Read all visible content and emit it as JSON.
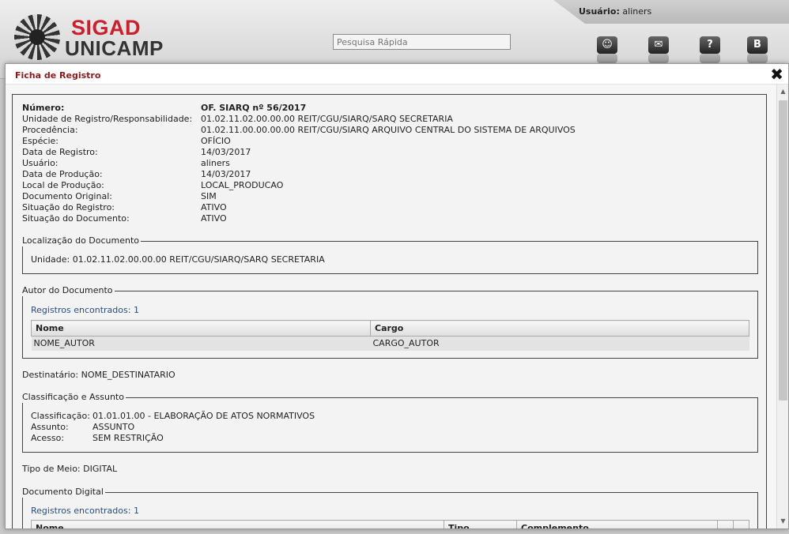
{
  "header": {
    "logo_line1": "SIGAD",
    "logo_line2": "UNICAMP",
    "search_placeholder": "Pesquisa Rápida",
    "user_label": "Usuário:",
    "user_name": "aliners",
    "icons": [
      "user-icon",
      "chat-icon",
      "help-icon",
      "logout-icon"
    ]
  },
  "modal": {
    "title": "Ficha de Registro",
    "close_symbol": "✖"
  },
  "registro": {
    "fields": [
      {
        "label": "Número:",
        "value": "OF. SIARQ nº 56/2017"
      },
      {
        "label": "Unidade de Registro/Responsabilidade:",
        "value": "01.02.11.02.00.00.00 REIT/CGU/SIARQ/SARQ SECRETARIA"
      },
      {
        "label": "Procedência:",
        "value": "01.02.11.00.00.00.00 REIT/CGU/SIARQ ARQUIVO CENTRAL DO SISTEMA DE ARQUIVOS"
      },
      {
        "label": "Espécie:",
        "value": "OFÍCIO"
      },
      {
        "label": "Data de Registro:",
        "value": "14/03/2017"
      },
      {
        "label": "Usuário:",
        "value": "aliners"
      },
      {
        "label": "Data de Produção:",
        "value": "14/03/2017"
      },
      {
        "label": "Local de Produção:",
        "value": "LOCAL_PRODUCAO"
      },
      {
        "label": "Documento Original:",
        "value": "SIM"
      },
      {
        "label": "Situação do Registro:",
        "value": "ATIVO"
      },
      {
        "label": "Situação do Documento:",
        "value": "ATIVO"
      }
    ]
  },
  "localizacao": {
    "legend": "Localização do Documento",
    "unidade_label": "Unidade:",
    "unidade_value": "01.02.11.02.00.00.00 REIT/CGU/SIARQ/SARQ SECRETARIA"
  },
  "autor": {
    "legend": "Autor do Documento",
    "found": "Registros encontrados: 1",
    "columns": [
      "Nome",
      "Cargo"
    ],
    "rows": [
      [
        "NOME_AUTOR",
        "CARGO_AUTOR"
      ]
    ]
  },
  "destinatario": {
    "label": "Destinatário:",
    "value": "NOME_DESTINATARIO"
  },
  "classificacao": {
    "legend": "Classificação e Assunto",
    "items": [
      {
        "label": "Classificação:",
        "value": "01.01.01.00 - ELABORAÇÃO DE ATOS NORMATIVOS"
      },
      {
        "label": "Assunto:",
        "value": "ASSUNTO"
      },
      {
        "label": "Acesso:",
        "value": "SEM RESTRIÇÃO"
      }
    ]
  },
  "tipo_meio": {
    "label": "Tipo de Meio:",
    "value": "DIGITAL"
  },
  "documento_digital": {
    "legend": "Documento Digital",
    "found": "Registros encontrados: 1",
    "columns": [
      "Nome",
      "Tipo",
      "Complemento",
      "",
      ""
    ]
  }
}
